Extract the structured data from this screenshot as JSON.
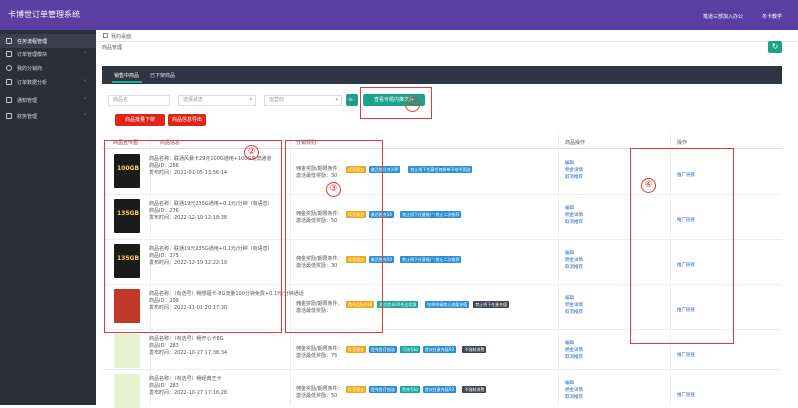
{
  "app": {
    "title": "卡博世订单管理系统",
    "user_a": "笔道三部加入办公",
    "user_b": "冬卡教学"
  },
  "sidebar": {
    "items": [
      {
        "label": "任务流程管理",
        "active": true
      },
      {
        "label": "订单管理模块",
        "active": false
      },
      {
        "label": "我的分销商",
        "active": false
      },
      {
        "label": "订单数据分析",
        "active": false
      },
      {
        "label": "通知管理",
        "active": false
      },
      {
        "label": "财务管理",
        "active": false
      }
    ]
  },
  "breadcrumb": "我的桌面",
  "page": {
    "subhead": "商品管理",
    "refresh_icon": "↻"
  },
  "tabs": [
    {
      "label": "销售中商品",
      "active": true
    },
    {
      "label": "已下架商品",
      "active": false
    }
  ],
  "filters": {
    "name_placeholder": "商品名",
    "status_placeholder": "选择状态",
    "type_placeholder": "运营商",
    "search_icon": "🔍",
    "edit_share_label": "查看专题内推文件",
    "btn_a": "商品批量下架",
    "btn_b": "商品信息导出"
  },
  "table": {
    "headers": [
      "商品宣传图",
      "商品信息",
      "分销规则",
      "商品操作",
      "操作"
    ],
    "rows": [
      {
        "thumb": "100GB",
        "title": "商品名称：联通风暴卡29元100G通用+100G免流通道",
        "id": "商品ID：286",
        "time": "发布时间：2022-01-05 13:56:14",
        "rule1": "佣金奖励/期限条件：",
        "rule2": "激活最低奖励：30",
        "tags": [
          [
            "续签佣金",
            "yellow"
          ],
          [
            "激活首月充100",
            "blue"
          ],
          [
            "禁止线下任意任何刷单不给予奖励",
            "blue"
          ]
        ],
        "actions": [
          "编辑",
          "佣金详情",
          "取消推荐"
        ],
        "promo": "推广链接"
      },
      {
        "thumb": "135GB",
        "title": "商品名称：联通19元235G通用+0.1元/分钟（有语音）",
        "id": "商品ID：276",
        "time": "发布时间：2022-12-19 12:18:38",
        "rule1": "佣金奖励/期限条件：",
        "rule2": "激活最低奖励：50",
        "tags": [
          [
            "续签佣金",
            "yellow"
          ],
          [
            "激活首充50",
            "blue"
          ],
          [
            "禁止线下任意推广-禁止二次推荐",
            "blue"
          ]
        ],
        "actions": [
          "编辑",
          "佣金详情",
          "取消推荐"
        ],
        "promo": "推广链接"
      },
      {
        "thumb": "135GB",
        "title": "商品名称：联通19元235G通用+0.1元/分钟（有语音）",
        "id": "商品ID：275",
        "time": "发布时间：2022-12-19 12:22:19",
        "rule1": "佣金奖励/期限条件：",
        "rule2": "激活最低奖励：30",
        "tags": [
          [
            "续签佣金",
            "yellow"
          ],
          [
            "激活首充50",
            "blue"
          ],
          [
            "禁止线下任意推广-禁止二次推荐",
            "blue"
          ]
        ],
        "actions": [
          "编辑",
          "佣金详情",
          "取消推荐"
        ],
        "promo": "推广链接"
      },
      {
        "thumb": "",
        "title": "商品名称：（有选号）畅想福卡-8G流量100分钟免费+0.1元/分钟通话",
        "id": "商品ID：209",
        "time": "发布时间：2022-11-01 20:17:30",
        "rule1": "佣金奖励/期限条件：",
        "rule2": "激活最低奖励：",
        "tags": [
          [
            "首充达标价格",
            "yellow"
          ],
          [
            "激活首充30任达优惠",
            "teal"
          ],
          [
            "在线申请禁止流量充值",
            "blue"
          ],
          [
            "禁止线下任意充值",
            "dark"
          ]
        ],
        "actions": [
          "编辑",
          "佣金详情",
          "取消推荐"
        ],
        "promo": "推广链接"
      },
      {
        "thumb": "",
        "title": "商品名称：（有选号）畅开心卡8G",
        "id": "商品ID：283",
        "time": "发布时间：2022-10-27 17:38:34",
        "rule1": "佣金奖励/期限条件：",
        "rule2": "激活最低奖励：75",
        "tags": [
          [
            "续签佣金",
            "yellow"
          ],
          [
            "首充首月加油",
            "blue"
          ],
          [
            "可选号码",
            "teal"
          ],
          [
            "首次任意充值50",
            "blue"
          ],
          [
            "不强制消费",
            "dark"
          ]
        ],
        "actions": [
          "编辑",
          "佣金详情",
          "取消推荐"
        ],
        "promo": "推广链接"
      },
      {
        "thumb": "",
        "title": "商品名称：（有选号）畅经典王卡",
        "id": "商品ID：283",
        "time": "发布时间：2022-10-27 17:16:28",
        "rule1": "佣金奖励/期限条件：",
        "rule2": "激活最低奖励：50",
        "tags": [
          [
            "续签佣金",
            "yellow"
          ],
          [
            "首充首月加油",
            "blue"
          ],
          [
            "首充号码",
            "teal"
          ],
          [
            "首次任意充值50",
            "blue"
          ],
          [
            "不强制消费",
            "dark"
          ]
        ],
        "actions": [
          "编辑",
          "佣金详情",
          "取消推荐"
        ],
        "promo": "推广链接"
      }
    ]
  },
  "annotations": [
    "①",
    "②",
    "③",
    "④"
  ],
  "colors": {
    "topbar": "#5b3fa0",
    "sidebar": "#2b2f3a",
    "accent": "#1aa28c",
    "danger": "#e2231a",
    "annotation": "#e53935"
  }
}
